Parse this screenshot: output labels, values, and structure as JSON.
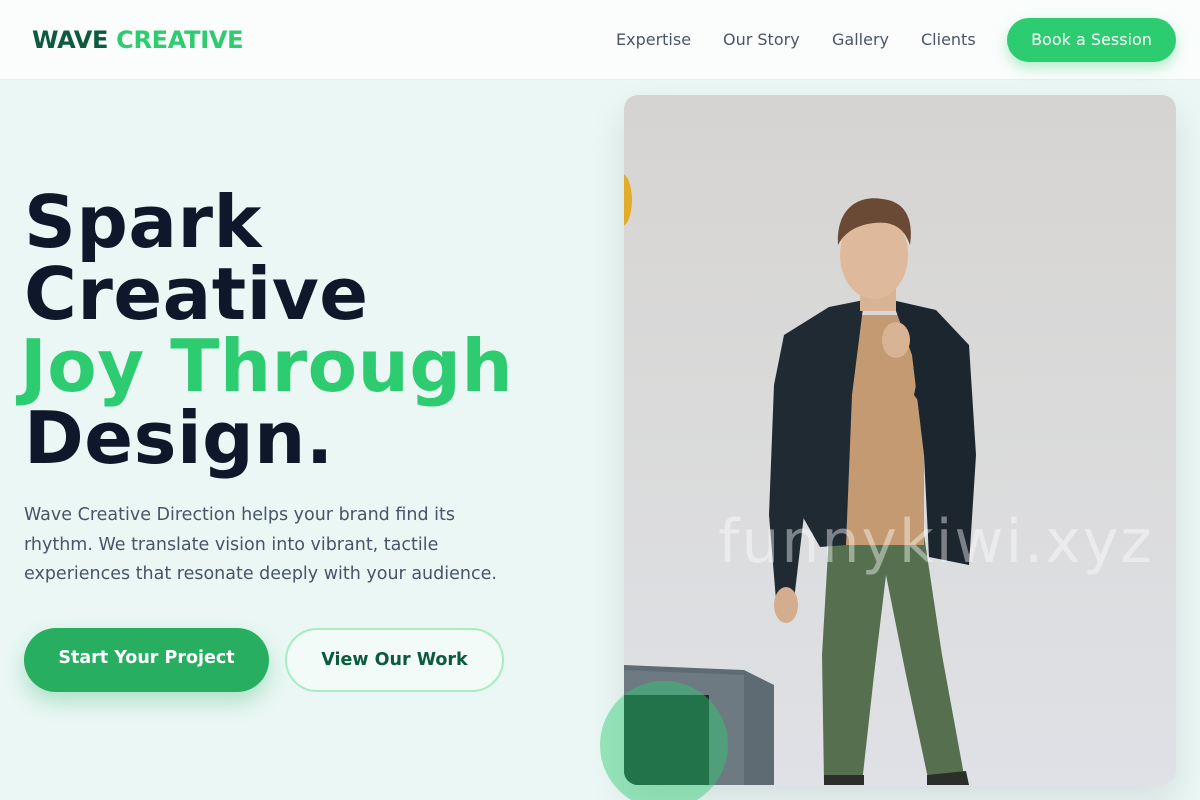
{
  "brand": {
    "word1": "WAVE",
    "word2": "CREATIVE",
    "primary_color": "#0d5a3f",
    "accent_color": "#2ecc71"
  },
  "nav": {
    "items": [
      {
        "label": "Expertise"
      },
      {
        "label": "Our Story"
      },
      {
        "label": "Gallery"
      },
      {
        "label": "Clients"
      }
    ],
    "cta_label": "Book a Session"
  },
  "hero": {
    "headline": {
      "line1": "Spark",
      "line2": "Creative",
      "line3_accent": "Joy Through",
      "line4": "Design."
    },
    "description": "Wave Creative Direction helps your brand find its rhythm. We translate vision into vibrant, tactile experiences that resonate deeply with your audience.",
    "primary_button": "Start Your Project",
    "secondary_button": "View Our Work",
    "image": {
      "subject": "man-in-blazer-photo",
      "watermark": "funnykiwi.xyz"
    }
  }
}
